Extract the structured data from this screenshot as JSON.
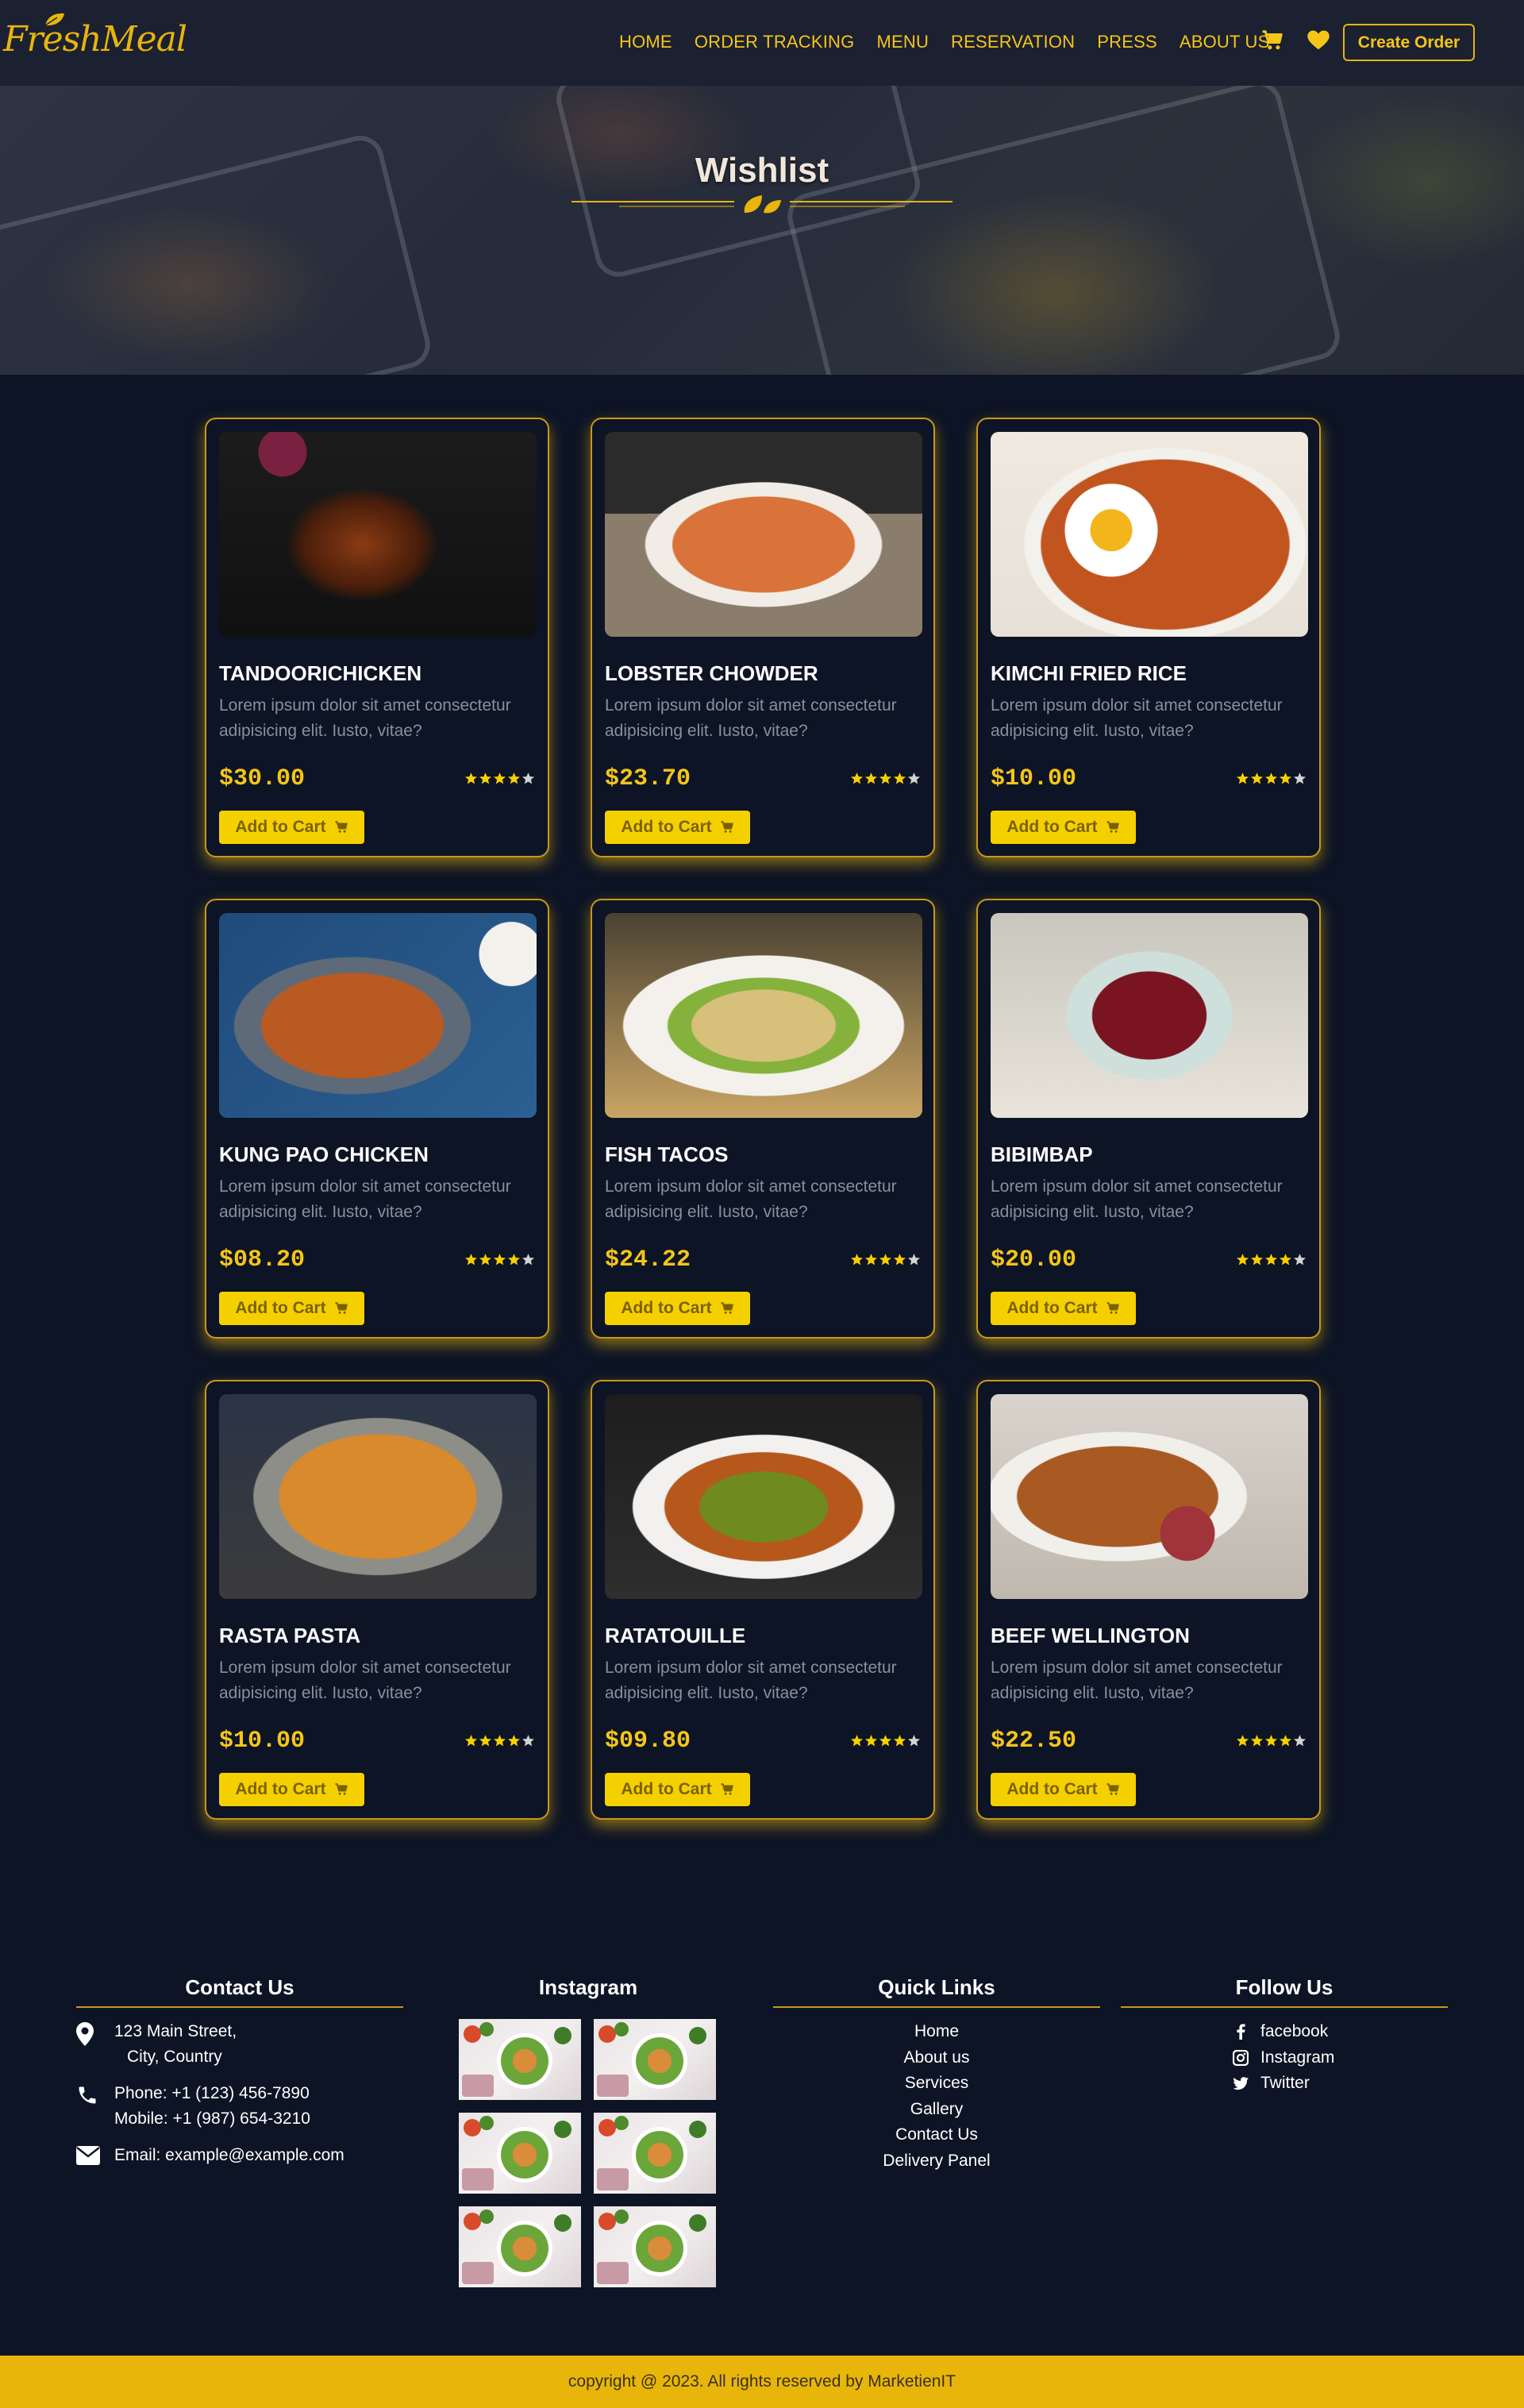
{
  "header": {
    "logo": "FreshMeal",
    "nav": [
      "HOME",
      "ORDER TRACKING",
      "MENU",
      "RESERVATION",
      "PRESS",
      "ABOUT US"
    ],
    "icons": [
      "cart-icon",
      "heart-icon"
    ],
    "create_order": "Create Order"
  },
  "hero": {
    "title": "Wishlist"
  },
  "cards": [
    {
      "name": "TANDOORICHICKEN",
      "desc": "Lorem ipsum dolor sit amet consectetur adipisicing elit. Iusto, vitae?",
      "price": "$30.00",
      "rating": 4,
      "button": "Add to Cart"
    },
    {
      "name": "LOBSTER CHOWDER",
      "desc": "Lorem ipsum dolor sit amet consectetur adipisicing elit. Iusto, vitae?",
      "price": "$23.70",
      "rating": 4,
      "button": "Add to Cart"
    },
    {
      "name": "KIMCHI FRIED RICE",
      "desc": "Lorem ipsum dolor sit amet consectetur adipisicing elit. Iusto, vitae?",
      "price": "$10.00",
      "rating": 4,
      "button": "Add to Cart"
    },
    {
      "name": "KUNG PAO CHICKEN",
      "desc": "Lorem ipsum dolor sit amet consectetur adipisicing elit. Iusto, vitae?",
      "price": "$08.20",
      "rating": 4,
      "button": "Add to Cart"
    },
    {
      "name": "FISH TACOS",
      "desc": "Lorem ipsum dolor sit amet consectetur adipisicing elit. Iusto, vitae?",
      "price": "$24.22",
      "rating": 4,
      "button": "Add to Cart"
    },
    {
      "name": "BIBIMBAP",
      "desc": "Lorem ipsum dolor sit amet consectetur adipisicing elit. Iusto, vitae?",
      "price": "$20.00",
      "rating": 4,
      "button": "Add to Cart"
    },
    {
      "name": "RASTA PASTA",
      "desc": "Lorem ipsum dolor sit amet consectetur adipisicing elit. Iusto, vitae?",
      "price": "$10.00",
      "rating": 4,
      "button": "Add to Cart"
    },
    {
      "name": "RATATOUILLE",
      "desc": "Lorem ipsum dolor sit amet consectetur adipisicing elit. Iusto, vitae?",
      "price": "$09.80",
      "rating": 4,
      "button": "Add to Cart"
    },
    {
      "name": "BEEF WELLINGTON",
      "desc": "Lorem ipsum dolor sit amet consectetur adipisicing elit. Iusto, vitae?",
      "price": "$22.50",
      "rating": 4,
      "button": "Add to Cart"
    }
  ],
  "footer": {
    "contact": {
      "title": "Contact Us",
      "address_line1": "123 Main Street,",
      "address_line2": "City, Country",
      "phone": "Phone: +1 (123) 456-7890",
      "mobile": "Mobile: +1 (987) 654-3210",
      "email": "Email: example@example.com"
    },
    "instagram": {
      "title": "Instagram"
    },
    "quick_links": {
      "title": "Quick Links",
      "items": [
        "Home",
        "About us",
        "Services",
        "Gallery",
        "Contact Us",
        "Delivery Panel"
      ]
    },
    "follow": {
      "title": "Follow Us",
      "items": [
        {
          "label": "facebook",
          "icon": "facebook-icon"
        },
        {
          "label": "Instagram",
          "icon": "instagram-icon"
        },
        {
          "label": "Twitter",
          "icon": "twitter-icon"
        }
      ]
    },
    "copyright": "copyright @ 2023. All rights reserved by MarketienIT"
  },
  "colors": {
    "accent": "#e8b50b",
    "background": "#0d1425",
    "header": "#1b2131",
    "button": "#f5d000"
  }
}
